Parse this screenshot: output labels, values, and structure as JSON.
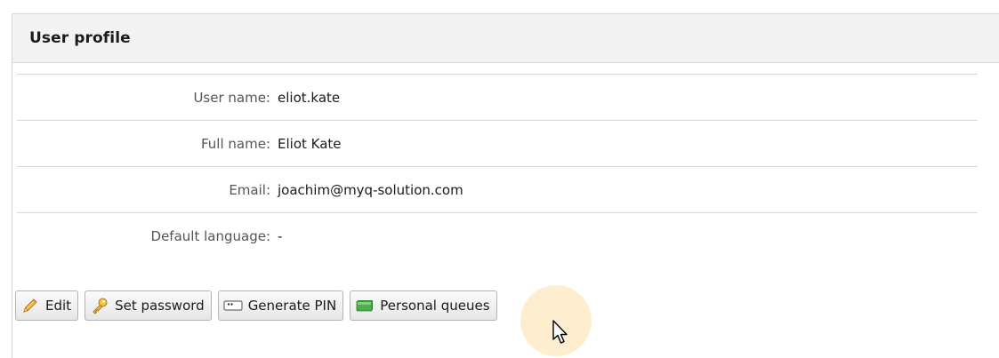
{
  "panel": {
    "title": "User profile"
  },
  "fields": [
    {
      "label": "User name:",
      "value": "eliot.kate"
    },
    {
      "label": "Full name:",
      "value": "Eliot Kate"
    },
    {
      "label": "Email:",
      "value": "joachim@myq-solution.com"
    },
    {
      "label": "Default language:",
      "value": "-"
    }
  ],
  "toolbar": {
    "edit": {
      "label": "Edit",
      "icon": "pencil-icon"
    },
    "set_password": {
      "label": "Set password",
      "icon": "key-icon"
    },
    "generate_pin": {
      "label": "Generate PIN",
      "icon": "pin-keypad-icon"
    },
    "personal_queues": {
      "label": "Personal queues",
      "icon": "queue-stack-icon"
    }
  },
  "colors": {
    "header_bg": "#f3f3f3",
    "border": "#d9d9d9",
    "label_text": "#555555",
    "value_text": "#1b1b1b",
    "click_highlight": "#ffd696"
  }
}
